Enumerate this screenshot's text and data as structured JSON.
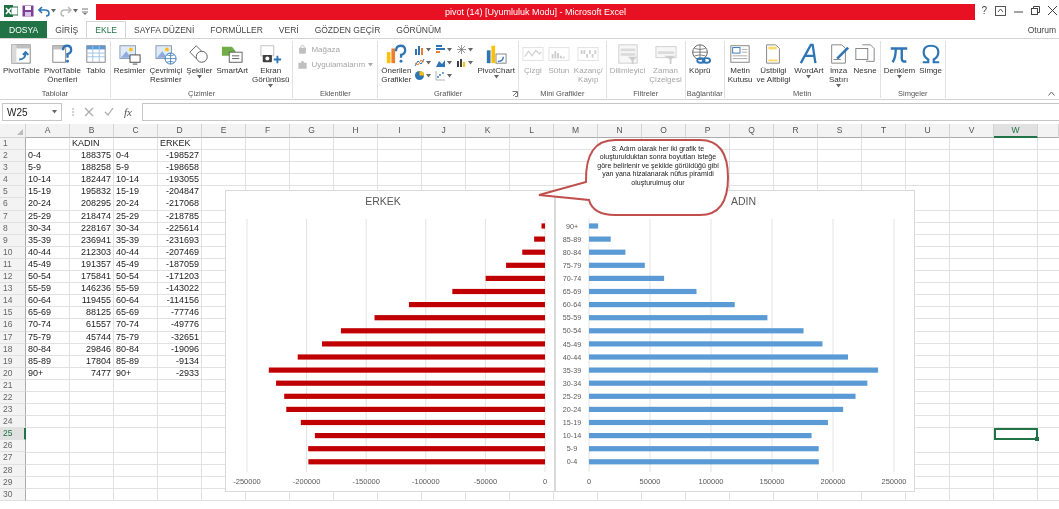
{
  "title_bar": {
    "title": "pivot (14)  [Uyumluluk Modu] - Microsoft Excel",
    "help": "?"
  },
  "ribbon_tabs": [
    {
      "label": "DOSYA",
      "kind": "file",
      "selected": false
    },
    {
      "label": "GİRİŞ",
      "kind": "tab",
      "selected": false
    },
    {
      "label": "EKLE",
      "kind": "tab",
      "selected": true
    },
    {
      "label": "SAYFA DÜZENİ",
      "kind": "tab",
      "selected": false
    },
    {
      "label": "FORMÜLLER",
      "kind": "tab",
      "selected": false
    },
    {
      "label": "VERİ",
      "kind": "tab",
      "selected": false
    },
    {
      "label": "GÖZDEN GEÇİR",
      "kind": "tab",
      "selected": false
    },
    {
      "label": "GÖRÜNÜM",
      "kind": "tab",
      "selected": false
    }
  ],
  "account": {
    "label": "Oturum"
  },
  "ribbon_groups": [
    {
      "label": "Tablolar",
      "items": [
        {
          "kind": "large",
          "label": "PivotTable",
          "disabled": false,
          "menu": false
        },
        {
          "kind": "large",
          "label": "PivotTable\nÖnerileri",
          "disabled": false,
          "menu": false
        },
        {
          "kind": "large",
          "label": "Tablo",
          "disabled": false,
          "menu": false
        }
      ]
    },
    {
      "label": "Çizimler",
      "items": [
        {
          "kind": "large",
          "label": "Resimler",
          "disabled": false,
          "menu": false
        },
        {
          "kind": "large",
          "label": "Çevrimiçi\nResimler",
          "disabled": false,
          "menu": false
        },
        {
          "kind": "large",
          "label": "Şekiller",
          "disabled": false,
          "menu": true
        },
        {
          "kind": "large",
          "label": "SmartArt",
          "disabled": false,
          "menu": false
        },
        {
          "kind": "large",
          "label": "Ekran\nGörüntüsü",
          "disabled": false,
          "menu": true
        }
      ]
    },
    {
      "label": "Eklentiler",
      "items": [
        {
          "kind": "small",
          "label": "Mağaza",
          "disabled": true,
          "menu": false
        },
        {
          "kind": "small",
          "label": "Uygulamalarım",
          "disabled": true,
          "menu": true
        }
      ]
    },
    {
      "label": "Grafikler",
      "launcher": true,
      "items": [
        {
          "kind": "large",
          "label": "Önerilen\nGrafikler",
          "disabled": false,
          "menu": false
        },
        {
          "kind": "gallery",
          "disabled": false
        },
        {
          "kind": "large",
          "label": "PivotChart",
          "disabled": false,
          "menu": true
        }
      ]
    },
    {
      "label": "Mini Grafikler",
      "items": [
        {
          "kind": "large",
          "label": "Çizgi",
          "disabled": true,
          "menu": false
        },
        {
          "kind": "large",
          "label": "Sütun",
          "disabled": true,
          "menu": false
        },
        {
          "kind": "large",
          "label": "Kazanç/\nKayıp",
          "disabled": true,
          "menu": false
        }
      ]
    },
    {
      "label": "Filtreler",
      "items": [
        {
          "kind": "large",
          "label": "Dilimleyici",
          "disabled": true,
          "menu": false
        },
        {
          "kind": "large",
          "label": "Zaman\nÇizelgesi",
          "disabled": true,
          "menu": false
        }
      ]
    },
    {
      "label": "Bağlantılar",
      "items": [
        {
          "kind": "large",
          "label": "Köprü",
          "disabled": false,
          "menu": false
        }
      ]
    },
    {
      "label": "Metin",
      "items": [
        {
          "kind": "large",
          "label": "Metin\nKutusu",
          "disabled": false,
          "menu": false
        },
        {
          "kind": "large",
          "label": "Üstbilgi\nve Altbilgi",
          "disabled": false,
          "menu": false
        },
        {
          "kind": "large",
          "label": "WordArt",
          "disabled": false,
          "menu": true
        },
        {
          "kind": "large",
          "label": "İmza\nSatırı",
          "disabled": false,
          "menu": true
        },
        {
          "kind": "large",
          "label": "Nesne",
          "disabled": false,
          "menu": false
        }
      ]
    },
    {
      "label": "Simgeler",
      "items": [
        {
          "kind": "large",
          "label": "Denklem",
          "disabled": false,
          "menu": true
        },
        {
          "kind": "large",
          "label": "Simge",
          "disabled": false,
          "menu": false
        }
      ]
    }
  ],
  "formula_bar": {
    "name_box": "W25",
    "function_label": "fx"
  },
  "sheet": {
    "columns": [
      {
        "label": "A",
        "selected": false
      },
      {
        "label": "B",
        "selected": false
      },
      {
        "label": "C",
        "selected": false
      },
      {
        "label": "D",
        "selected": false
      },
      {
        "label": "E",
        "selected": false
      },
      {
        "label": "F",
        "selected": false
      },
      {
        "label": "G",
        "selected": false
      },
      {
        "label": "H",
        "selected": false
      },
      {
        "label": "I",
        "selected": false
      },
      {
        "label": "J",
        "selected": false
      },
      {
        "label": "K",
        "selected": false
      },
      {
        "label": "L",
        "selected": false
      },
      {
        "label": "M",
        "selected": false
      },
      {
        "label": "N",
        "selected": false
      },
      {
        "label": "O",
        "selected": false
      },
      {
        "label": "P",
        "selected": false
      },
      {
        "label": "Q",
        "selected": false
      },
      {
        "label": "R",
        "selected": false
      },
      {
        "label": "S",
        "selected": false
      },
      {
        "label": "T",
        "selected": false
      },
      {
        "label": "U",
        "selected": false
      },
      {
        "label": "V",
        "selected": false
      },
      {
        "label": "W",
        "selected": true
      }
    ],
    "header_row": {
      "number": "1",
      "selected": false,
      "column_b": "KADIN",
      "column_d": "ERKEK"
    },
    "rows": [
      {
        "number": "2",
        "selected": false,
        "cells": [
          "0-4",
          "188375",
          "0-4",
          "-198527"
        ]
      },
      {
        "number": "3",
        "selected": false,
        "cells": [
          "5-9",
          "188258",
          "5-9",
          "-198658"
        ]
      },
      {
        "number": "4",
        "selected": false,
        "cells": [
          "10-14",
          "182447",
          "10-14",
          "-193055"
        ]
      },
      {
        "number": "5",
        "selected": false,
        "cells": [
          "15-19",
          "195832",
          "15-19",
          "-204847"
        ]
      },
      {
        "number": "6",
        "selected": false,
        "cells": [
          "20-24",
          "208295",
          "20-24",
          "-217068"
        ]
      },
      {
        "number": "7",
        "selected": false,
        "cells": [
          "25-29",
          "218474",
          "25-29",
          "-218785"
        ]
      },
      {
        "number": "8",
        "selected": false,
        "cells": [
          "30-34",
          "228167",
          "30-34",
          "-225614"
        ]
      },
      {
        "number": "9",
        "selected": false,
        "cells": [
          "35-39",
          "236941",
          "35-39",
          "-231693"
        ]
      },
      {
        "number": "10",
        "selected": false,
        "cells": [
          "40-44",
          "212303",
          "40-44",
          "-207469"
        ]
      },
      {
        "number": "11",
        "selected": false,
        "cells": [
          "45-49",
          "191357",
          "45-49",
          "-187059"
        ]
      },
      {
        "number": "12",
        "selected": false,
        "cells": [
          "50-54",
          "175841",
          "50-54",
          "-171203"
        ]
      },
      {
        "number": "13",
        "selected": false,
        "cells": [
          "55-59",
          "146236",
          "55-59",
          "-143022"
        ]
      },
      {
        "number": "14",
        "selected": false,
        "cells": [
          "60-64",
          "119455",
          "60-64",
          "-114156"
        ]
      },
      {
        "number": "15",
        "selected": false,
        "cells": [
          "65-69",
          "88125",
          "65-69",
          "-77746"
        ]
      },
      {
        "number": "16",
        "selected": false,
        "cells": [
          "70-74",
          "61557",
          "70-74",
          "-49776"
        ]
      },
      {
        "number": "17",
        "selected": false,
        "cells": [
          "75-79",
          "45744",
          "75-79",
          "-32651"
        ]
      },
      {
        "number": "18",
        "selected": false,
        "cells": [
          "80-84",
          "29846",
          "80-84",
          "-19096"
        ]
      },
      {
        "number": "19",
        "selected": false,
        "cells": [
          "85-89",
          "17804",
          "85-89",
          "-9134"
        ]
      },
      {
        "number": "20",
        "selected": false,
        "cells": [
          "90+",
          "7477",
          "90+",
          "-2933"
        ]
      },
      {
        "number": "21",
        "selected": false
      },
      {
        "number": "22",
        "selected": false
      },
      {
        "number": "23",
        "selected": false
      },
      {
        "number": "24",
        "selected": false
      },
      {
        "number": "25",
        "selected": true
      },
      {
        "number": "26",
        "selected": false
      },
      {
        "number": "27",
        "selected": false
      },
      {
        "number": "28",
        "selected": false
      },
      {
        "number": "29",
        "selected": false
      },
      {
        "number": "30",
        "selected": false
      }
    ],
    "charts": [
      {
        "chart_data": {
          "type": "bar",
          "orientation": "horizontal",
          "title": "ERKEK",
          "grid": true,
          "series": [
            {
              "color": "#c00000",
              "values": [
                -2933,
                -9134,
                -19096,
                -32651,
                -49776,
                -77746,
                -114156,
                -143022,
                -171203,
                -187059,
                -207469,
                -231693,
                -225614,
                -218785,
                -217068,
                -204847,
                -193055,
                -198658,
                -198527
              ]
            }
          ],
          "xlim": [
            -250000,
            0
          ],
          "xticks": [
            -250000,
            -200000,
            -150000,
            -100000,
            -50000,
            0
          ]
        }
      },
      {
        "chart_data": {
          "type": "bar",
          "orientation": "horizontal",
          "title": "ADIN",
          "grid": true,
          "categories": [
            "90+",
            "85-89",
            "80-84",
            "75-79",
            "70-74",
            "65-69",
            "60-64",
            "55-59",
            "50-54",
            "45-49",
            "40-44",
            "35-39",
            "30-34",
            "25-29",
            "20-24",
            "15-19",
            "10-14",
            "5-9",
            "0-4"
          ],
          "series": [
            {
              "color": "#5b9bd5",
              "values": [
                7477,
                17804,
                29846,
                45744,
                61557,
                88125,
                119455,
                146236,
                175841,
                191357,
                212303,
                236941,
                228167,
                218474,
                208295,
                195832,
                182447,
                188258,
                188375
              ]
            }
          ],
          "xlim": [
            0,
            250000
          ],
          "xticks": [
            0,
            50000,
            100000,
            150000,
            200000,
            250000
          ]
        }
      }
    ],
    "callout": {
      "text": "8. Adım olarak her iki grafik te oluşturulduktan sonra boyutları isteğe göre belirlenir ve şekilde görüldüğü gibi yan yana hizalanarak nüfus piramidi oluşturulmuş olur"
    }
  }
}
